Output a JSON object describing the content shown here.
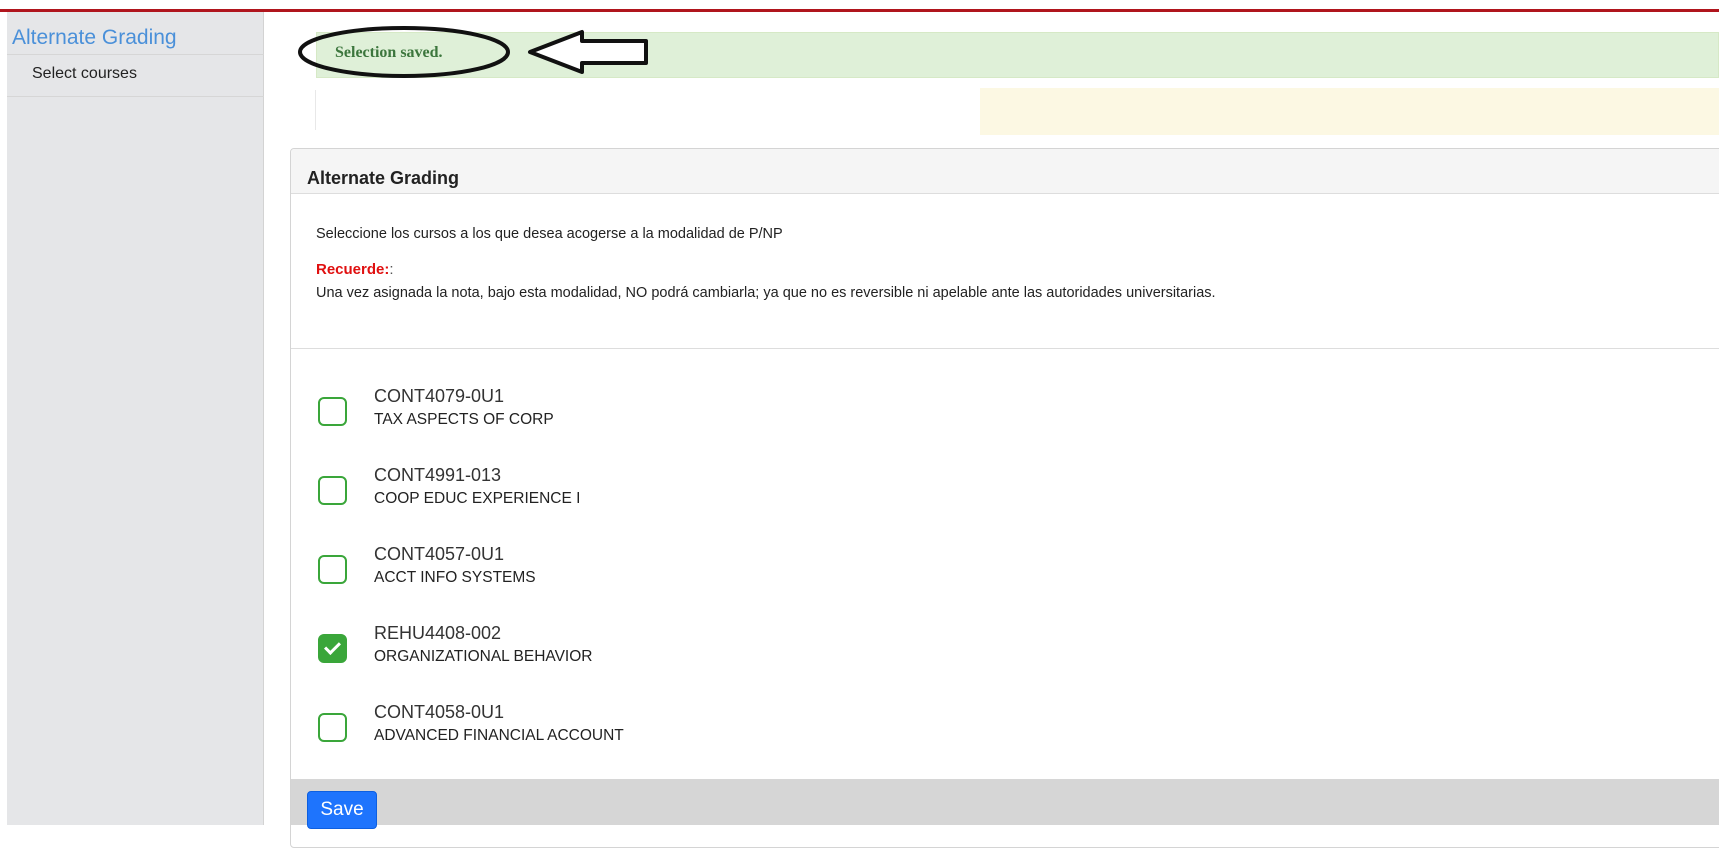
{
  "sidebar": {
    "title": "Alternate Grading",
    "items": [
      {
        "label": "Select courses"
      }
    ]
  },
  "alert": {
    "success_message": "Selection saved."
  },
  "panel": {
    "title": "Alternate Grading",
    "instruction": "Seleccione los cursos a los que desea acogerse a la modalidad de P/NP",
    "remember_label": "Recuerde:",
    "remember_colon": ":",
    "remember_text": "Una vez asignada la nota, bajo esta modalidad, NO podrá cambiarla; ya que no es reversible ni apelable ante las autoridades universitarias."
  },
  "courses": [
    {
      "code": "CONT4079-0U1",
      "name": "TAX ASPECTS OF CORP",
      "checked": false
    },
    {
      "code": "CONT4991-013",
      "name": "COOP EDUC EXPERIENCE I",
      "checked": false
    },
    {
      "code": "CONT4057-0U1",
      "name": "ACCT INFO SYSTEMS",
      "checked": false
    },
    {
      "code": "REHU4408-002",
      "name": "ORGANIZATIONAL BEHAVIOR",
      "checked": true
    },
    {
      "code": "CONT4058-0U1",
      "name": "ADVANCED FINANCIAL ACCOUNT",
      "checked": false
    }
  ],
  "footer": {
    "save_label": "Save"
  },
  "colors": {
    "top_accent": "#b0151d",
    "link": "#4a90d9",
    "success_bg": "#dff0d8",
    "success_text": "#3c763d",
    "checkbox_green": "#3aa63a",
    "primary_button": "#1e74fd",
    "warning_red": "#e01010"
  },
  "icons": {
    "annotation": "ellipse-and-arrow-annotation",
    "checkbox_checked": "checkmark-icon"
  }
}
